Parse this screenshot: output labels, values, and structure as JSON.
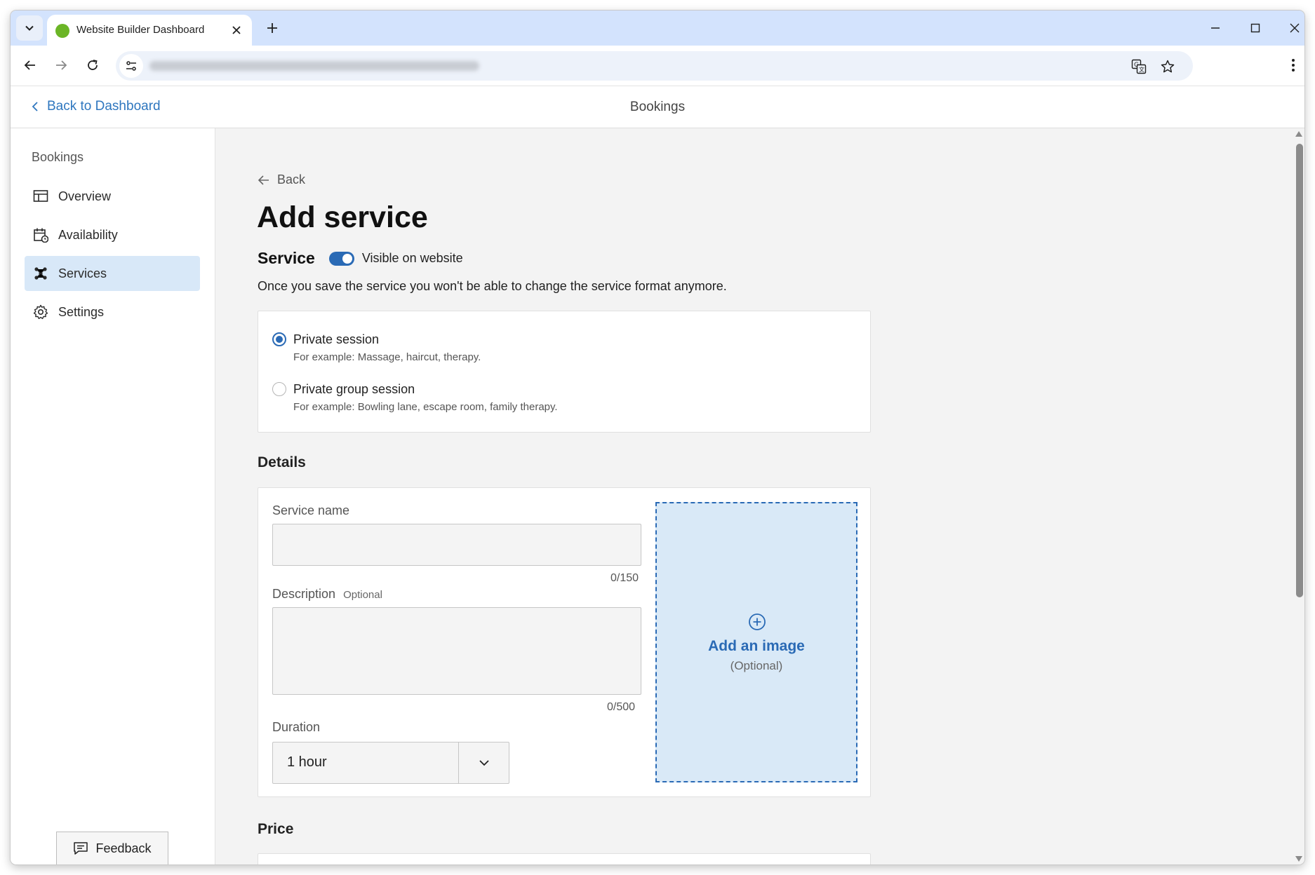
{
  "browser": {
    "tab_title": "Website Builder Dashboard"
  },
  "header": {
    "back_label": "Back to Dashboard",
    "title": "Bookings"
  },
  "sidebar": {
    "heading": "Bookings",
    "items": [
      {
        "label": "Overview",
        "icon": "layout-icon"
      },
      {
        "label": "Availability",
        "icon": "calendar-clock-icon"
      },
      {
        "label": "Services",
        "icon": "services-icon",
        "active": true
      },
      {
        "label": "Settings",
        "icon": "gear-icon"
      }
    ],
    "feedback_label": "Feedback"
  },
  "main": {
    "back_label": "Back",
    "page_title": "Add service",
    "service_label": "Service",
    "visible_label": "Visible on website",
    "visible_on": true,
    "format_note": "Once you save the service you won't be able to change the service format anymore.",
    "formats": [
      {
        "title": "Private session",
        "example": "For example: Massage, haircut, therapy.",
        "selected": true
      },
      {
        "title": "Private group session",
        "example": "For example: Bowling lane, escape room, family therapy.",
        "selected": false
      }
    ],
    "details_heading": "Details",
    "service_name_label": "Service name",
    "service_name_value": "",
    "service_name_counter": "0/150",
    "description_label": "Description",
    "description_optional": "Optional",
    "description_value": "",
    "description_counter": "0/500",
    "duration_label": "Duration",
    "duration_value": "1 hour",
    "image_label": "Add an image",
    "image_optional": "(Optional)",
    "price_heading": "Price"
  },
  "colors": {
    "accent": "#2a6ab5",
    "link": "#2f77bf",
    "active_nav_bg": "#d8e8f8",
    "tabstrip_bg": "#d3e3fd",
    "content_bg": "#f3f3f3"
  }
}
